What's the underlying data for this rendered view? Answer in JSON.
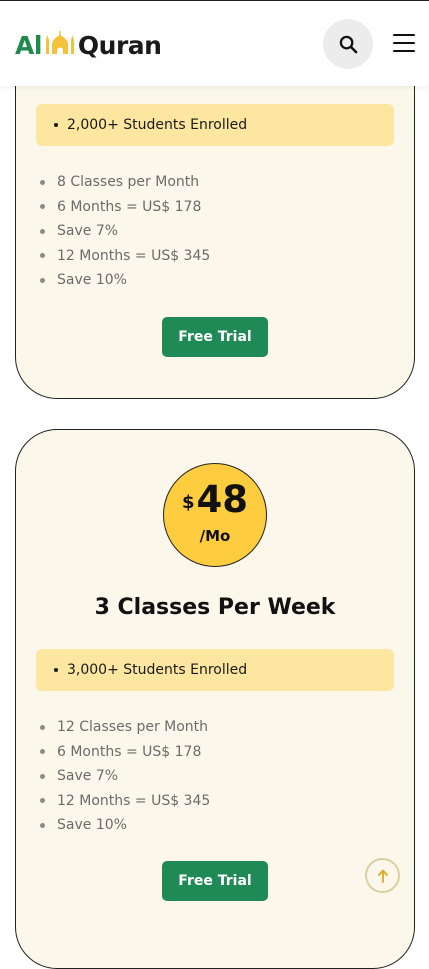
{
  "header": {
    "logo_prefix": "Al",
    "logo_suffix": "Quran",
    "search_icon": "search-icon",
    "menu_icon": "hamburger-menu-icon"
  },
  "colors": {
    "brand_green": "#1f8a4c",
    "button_green": "#1f8a55",
    "price_yellow": "#fdcd3f",
    "enrolled_bg": "#fde6a0",
    "card_bg": "#fbf8eb"
  },
  "plans": [
    {
      "enrolled": "2,000+ Students Enrolled",
      "features": [
        "8 Classes per Month",
        "6 Months = US$ 178",
        "Save 7%",
        "12 Months = US$ 345",
        "Save 10%"
      ],
      "cta": "Free Trial"
    },
    {
      "price_symbol": "$",
      "price_value": "48",
      "price_period": "/Mo",
      "title": "3 Classes Per Week",
      "enrolled": "3,000+ Students Enrolled",
      "features": [
        "12 Classes per Month",
        "6 Months = US$ 178",
        "Save 7%",
        "12 Months = US$ 345",
        "Save 10%"
      ],
      "cta": "Free Trial"
    }
  ],
  "scroll_top_icon": "arrow-up-icon"
}
